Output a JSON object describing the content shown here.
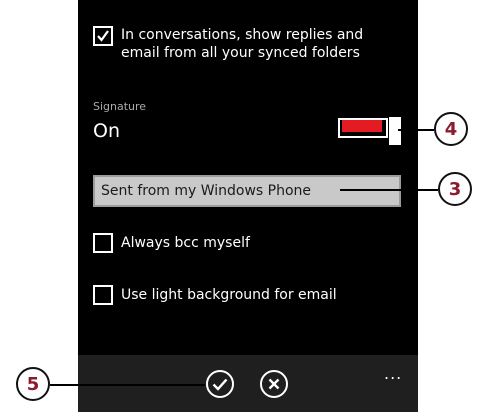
{
  "settings": {
    "conversations_option": {
      "label_line1": "In conversations, show replies and",
      "label_line2": "email from all your synced folders",
      "checked": true
    },
    "signature": {
      "caption": "Signature",
      "state": "On",
      "text": "Sent from my Windows Phone"
    },
    "always_bcc": {
      "label": "Always bcc myself",
      "checked": false
    },
    "light_background": {
      "label": "Use light background for email",
      "checked": false
    }
  },
  "app_bar": {
    "more_label": "..."
  },
  "callouts": {
    "toggle": "4",
    "signature_field": "3",
    "save": "5"
  },
  "colors": {
    "toggle_accent": "#e31b23",
    "callout_text": "#8b1b2d",
    "phone_bg": "#000000"
  }
}
